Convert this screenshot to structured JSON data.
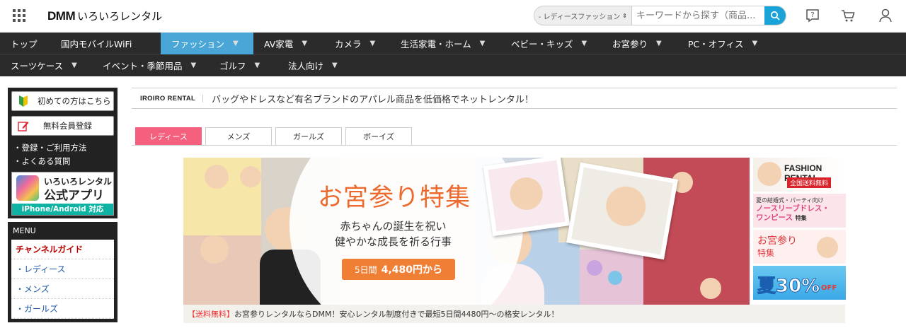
{
  "header": {
    "logo_dmm": "DMM",
    "logo_name": "いろいろレンタル",
    "search": {
      "category": "- レディースファッション",
      "placeholder": "キーワードから探す（商品..."
    }
  },
  "nav": {
    "row1": [
      "トップ",
      "国内モバイルWiFi",
      "ファッション",
      "AV家電",
      "カメラ",
      "生活家電・ホーム",
      "ベビー・キッズ",
      "お宮参り",
      "PC・オフィス"
    ],
    "row2": [
      "スーツケース",
      "イベント・季節用品",
      "ゴルフ",
      "法人向け"
    ],
    "active": "ファッション"
  },
  "sidebar": {
    "first_time": "初めての方はこちら",
    "register": "無料会員登録",
    "links": [
      "登録・ご利用方法",
      "よくある質問"
    ],
    "app": {
      "line1": "いろいろレンタル",
      "line2": "公式アプリ",
      "bar": "iPhone/Android 対応"
    },
    "menu": {
      "heading": "MENU",
      "channel": "チャンネルガイド",
      "items": [
        "・レディース",
        "・メンズ",
        "・ガールズ"
      ]
    }
  },
  "main": {
    "brand": "IROIRO RENTAL",
    "description": "バッグやドレスなど有名ブランドのアパレル商品を低価格でネットレンタル！",
    "tabs": [
      "レディース",
      "メンズ",
      "ガールズ",
      "ボーイズ"
    ],
    "active_tab": "レディース",
    "banner": {
      "title": "お宮参り特集",
      "sub1": "赤ちゃんの誕生を祝い",
      "sub2": "健やかな成長を祈る行事",
      "price_days": "5日間",
      "price": "4,480円から"
    },
    "caption_red": "【送料無料】",
    "caption": "お宮参りレンタルならDMM！安心レンタル制度付きで最短5日間4480円～の格安レンタル！",
    "side": {
      "b1_title": "FASHION RENTAL",
      "b1_ribbon": "全国送料無料",
      "b2_small": "夏の結婚式・パーティ向け",
      "b2_main1": "ノースリーブドレス・",
      "b2_main2": "ワンピース",
      "b2_tail": "特集",
      "b3_1": "お宮参り",
      "b3_2": "特集",
      "b4": "夏30%",
      "b4_off": "OFF"
    }
  },
  "colors": {
    "nav_bg": "#2b2b2b",
    "nav_active": "#4aa6d6",
    "tab_active": "#f4607e",
    "search_button": "#1aa3d8",
    "banner_title": "#ec6a2d",
    "price_button": "#ef7f35"
  }
}
